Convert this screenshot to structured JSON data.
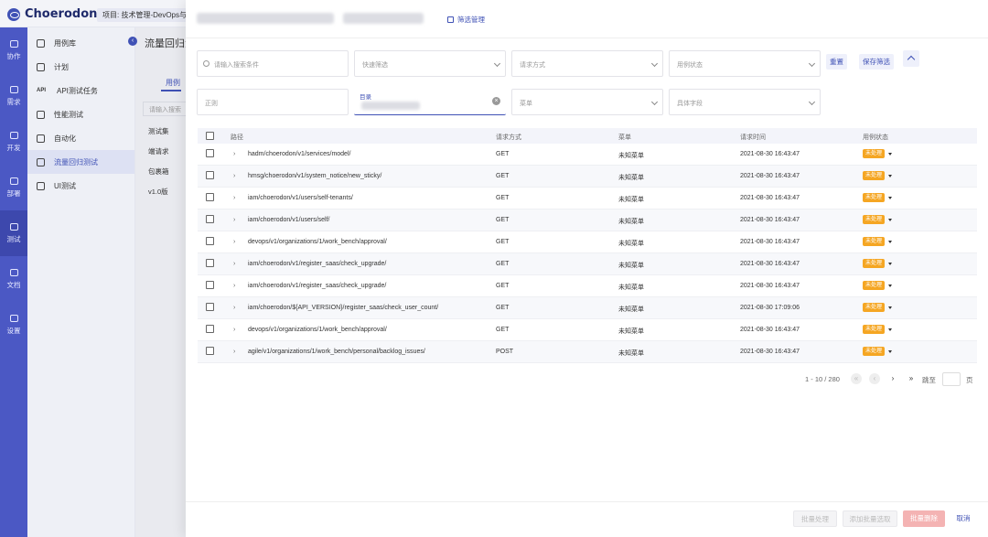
{
  "app": {
    "name": "Choerodon",
    "project": "项目: 技术管理-DevOps与容"
  },
  "rail": [
    {
      "label": "协作",
      "icon": "collaborate-icon"
    },
    {
      "label": "需求",
      "icon": "requirement-icon"
    },
    {
      "label": "开发",
      "icon": "code-icon"
    },
    {
      "label": "部署",
      "icon": "deploy-icon"
    },
    {
      "label": "测试",
      "icon": "test-icon"
    },
    {
      "label": "文档",
      "icon": "document-icon"
    },
    {
      "label": "设置",
      "icon": "settings-icon"
    }
  ],
  "subnav": [
    {
      "label": "用例库",
      "icon": "case-library-icon"
    },
    {
      "label": "计划",
      "icon": "plan-icon"
    },
    {
      "label": "API测试任务",
      "icon": "api-icon",
      "prefix": "API"
    },
    {
      "label": "性能测试",
      "icon": "performance-icon"
    },
    {
      "label": "自动化",
      "icon": "automation-icon"
    },
    {
      "label": "流量回归测试",
      "icon": "traffic-icon"
    },
    {
      "label": "UI测试",
      "icon": "ui-test-icon"
    }
  ],
  "background": {
    "title": "流量回归测试",
    "tab": "用例",
    "search_placeholder": "请输入搜索",
    "tree": [
      "测试集",
      "端请求",
      "包裹箱",
      "v1.0版"
    ]
  },
  "drawer": {
    "manage_label": "筛选管理",
    "filters": {
      "search_placeholder": "请输入搜索条件",
      "quick_filter": "快速筛选",
      "method": "请求方式",
      "status": "用例状态",
      "rule": "正则",
      "directory_label": "目录",
      "menu": "菜单",
      "specific_field": "具体字段",
      "reset": "重置",
      "save_filter": "保存筛选"
    },
    "columns": {
      "path": "路径",
      "method": "请求方式",
      "menu": "菜单",
      "time": "请求时间",
      "status": "用例状态"
    },
    "rows": [
      {
        "path": "hadm/choerodon/v1/services/model/",
        "method": "GET",
        "menu": "未知菜单",
        "time": "2021-08-30 16:43:47",
        "status": "未处理"
      },
      {
        "path": "hmsg/choerodon/v1/system_notice/new_sticky/",
        "method": "GET",
        "menu": "未知菜单",
        "time": "2021-08-30 16:43:47",
        "status": "未处理"
      },
      {
        "path": "iam/choerodon/v1/users/self-tenants/",
        "method": "GET",
        "menu": "未知菜单",
        "time": "2021-08-30 16:43:47",
        "status": "未处理"
      },
      {
        "path": "iam/choerodon/v1/users/self/",
        "method": "GET",
        "menu": "未知菜单",
        "time": "2021-08-30 16:43:47",
        "status": "未处理"
      },
      {
        "path": "devops/v1/organizations/1/work_bench/approval/",
        "method": "GET",
        "menu": "未知菜单",
        "time": "2021-08-30 16:43:47",
        "status": "未处理"
      },
      {
        "path": "iam/choerodon/v1/register_saas/check_upgrade/",
        "method": "GET",
        "menu": "未知菜单",
        "time": "2021-08-30 16:43:47",
        "status": "未处理"
      },
      {
        "path": "iam/choerodon/v1/register_saas/check_upgrade/",
        "method": "GET",
        "menu": "未知菜单",
        "time": "2021-08-30 16:43:47",
        "status": "未处理"
      },
      {
        "path": "iam/choerodon/${API_VERSION}/register_saas/check_user_count/",
        "method": "GET",
        "menu": "未知菜单",
        "time": "2021-08-30 17:09:06",
        "status": "未处理"
      },
      {
        "path": "devops/v1/organizations/1/work_bench/approval/",
        "method": "GET",
        "menu": "未知菜单",
        "time": "2021-08-30 16:43:47",
        "status": "未处理"
      },
      {
        "path": "agile/v1/organizations/1/work_bench/personal/backlog_issues/",
        "method": "POST",
        "menu": "未知菜单",
        "time": "2021-08-30 16:43:47",
        "status": "未处理"
      }
    ],
    "pagination": {
      "range": "1 - 10 / 280",
      "jump_label": "跳至",
      "page_unit": "页"
    },
    "footer": {
      "batch_process": "批量处理",
      "add_to_batch": "添加批量选取",
      "batch_delete": "批量删除",
      "cancel": "取消"
    }
  }
}
